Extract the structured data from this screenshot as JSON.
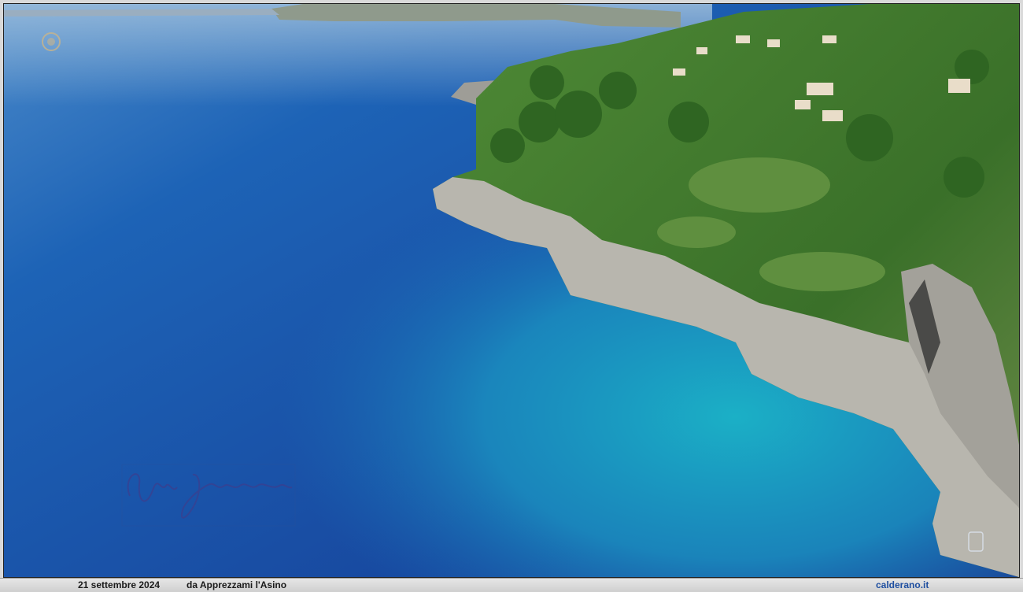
{
  "photo": {
    "subject": "Aerial view of rocky coastline with turquoise sea",
    "watermark_signature": "Calderano",
    "colors": {
      "deep_sea": "#1b4fa6",
      "turquoise": "#1aa3c4",
      "rock": "#b9b7b0",
      "vegetation": "#3f7a2e"
    }
  },
  "caption": {
    "date": "21 settembre 2024",
    "source": "da Apprezzami l'Asino",
    "site": "calderano.it"
  }
}
